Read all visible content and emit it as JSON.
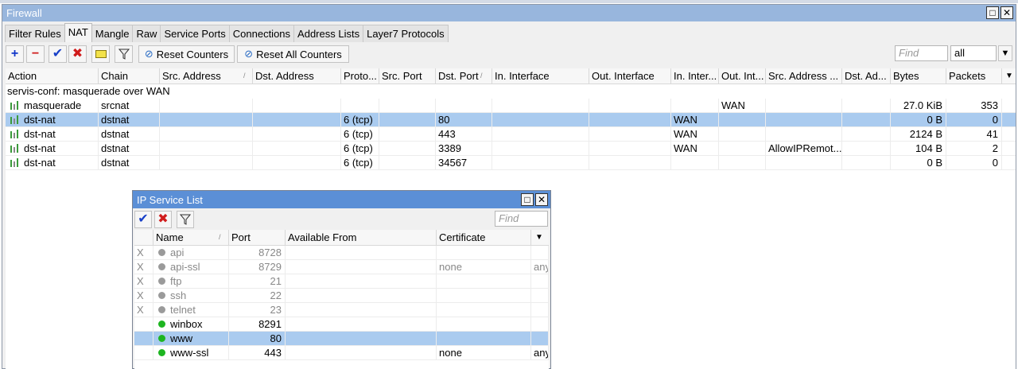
{
  "firewall": {
    "title": "Firewall",
    "tabs": [
      "Filter Rules",
      "NAT",
      "Mangle",
      "Raw",
      "Service Ports",
      "Connections",
      "Address Lists",
      "Layer7 Protocols"
    ],
    "active_tab": "NAT",
    "toolbar": {
      "reset_counters": "Reset Counters",
      "reset_all_counters": "Reset All Counters",
      "find_placeholder": "Find",
      "filter_value": "all"
    },
    "columns": [
      "Action",
      "Chain",
      "Src. Address",
      "Dst. Address",
      "Proto...",
      "Src. Port",
      "Dst. Port",
      "In. Interface",
      "Out. Interface",
      "In. Inter...",
      "Out. Int...",
      "Src. Address ...",
      "Dst. Ad...",
      "Bytes",
      "Packets"
    ],
    "comment": "servis-conf: masquerade over WAN",
    "rows": [
      {
        "action": "masquerade",
        "chain": "srcnat",
        "proto": "",
        "dst_port": "",
        "in_iface": "",
        "out_iface": "WAN",
        "src_list": "",
        "bytes": "27.0 KiB",
        "packets": "353"
      },
      {
        "action": "dst-nat",
        "chain": "dstnat",
        "proto": "6 (tcp)",
        "dst_port": "80",
        "in_iface": "WAN",
        "out_iface": "",
        "src_list": "",
        "bytes": "0 B",
        "packets": "0"
      },
      {
        "action": "dst-nat",
        "chain": "dstnat",
        "proto": "6 (tcp)",
        "dst_port": "443",
        "in_iface": "WAN",
        "out_iface": "",
        "src_list": "",
        "bytes": "2124 B",
        "packets": "41"
      },
      {
        "action": "dst-nat",
        "chain": "dstnat",
        "proto": "6 (tcp)",
        "dst_port": "3389",
        "in_iface": "WAN",
        "out_iface": "",
        "src_list": "AllowIPRemot...",
        "bytes": "104 B",
        "packets": "2"
      },
      {
        "action": "dst-nat",
        "chain": "dstnat",
        "proto": "6 (tcp)",
        "dst_port": "34567",
        "in_iface": "",
        "out_iface": "",
        "src_list": "",
        "bytes": "0 B",
        "packets": "0"
      }
    ],
    "selected_row": 1
  },
  "ip_service_list": {
    "title": "IP Service List",
    "find_placeholder": "Find",
    "columns": [
      "Name",
      "Port",
      "Available From",
      "Certificate"
    ],
    "rows": [
      {
        "flag": "X",
        "name": "api",
        "port": "8728",
        "cert": "",
        "extra": "",
        "enabled": false
      },
      {
        "flag": "X",
        "name": "api-ssl",
        "port": "8729",
        "cert": "none",
        "extra": "any",
        "enabled": false
      },
      {
        "flag": "X",
        "name": "ftp",
        "port": "21",
        "cert": "",
        "extra": "",
        "enabled": false
      },
      {
        "flag": "X",
        "name": "ssh",
        "port": "22",
        "cert": "",
        "extra": "",
        "enabled": false
      },
      {
        "flag": "X",
        "name": "telnet",
        "port": "23",
        "cert": "",
        "extra": "",
        "enabled": false
      },
      {
        "flag": "",
        "name": "winbox",
        "port": "8291",
        "cert": "",
        "extra": "",
        "enabled": true
      },
      {
        "flag": "",
        "name": "www",
        "port": "80",
        "cert": "",
        "extra": "",
        "enabled": true
      },
      {
        "flag": "",
        "name": "www-ssl",
        "port": "443",
        "cert": "none",
        "extra": "any",
        "enabled": true
      }
    ],
    "selected_row": 6
  },
  "colors": {
    "titlebar_inactive": "#98b6dd",
    "titlebar_active": "#5b8fd6",
    "selection": "#aacbef",
    "enabled_dot": "#1db520",
    "disabled_dot": "#9a9a9a"
  }
}
